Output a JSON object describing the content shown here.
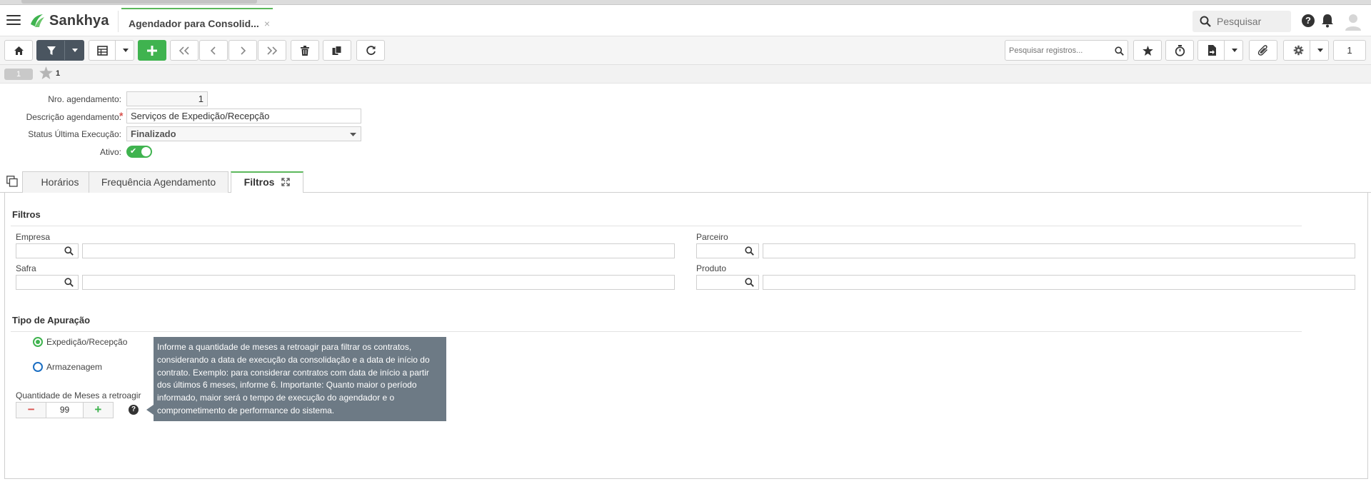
{
  "header": {
    "brand": "Sankhya",
    "app_tab_title": "Agendador para Consolid...",
    "close_label": "×",
    "search_placeholder": "Pesquisar",
    "help_label": "?"
  },
  "toolbar": {
    "search_placeholder": "Pesquisar registros...",
    "page_number": "1",
    "icons": [
      "home-icon",
      "filter-icon",
      "grid-icon",
      "add-icon",
      "first-icon",
      "prev-icon",
      "next-icon",
      "last-icon",
      "trash-icon",
      "duplicate-icon",
      "refresh-icon",
      "star-icon",
      "timer-icon",
      "report-icon",
      "attach-icon",
      "gear-icon"
    ]
  },
  "record_bar": {
    "pill": "1",
    "record_number": "1"
  },
  "form": {
    "nro_label": "Nro. agendamento:",
    "nro_value": "1",
    "descricao_label": "Descrição agendamento:",
    "required_mark": "*",
    "descricao_value": "Serviços de Expedição/Recepção",
    "status_label": "Status Última Execução:",
    "status_value": "Finalizado",
    "ativo_label": "Ativo:",
    "ativo_on": true
  },
  "tabs": [
    {
      "label": "Horários",
      "active": false
    },
    {
      "label": "Frequência Agendamento",
      "active": false
    },
    {
      "label": "Filtros",
      "active": true
    }
  ],
  "filtros": {
    "title": "Filtros",
    "empresa_label": "Empresa",
    "parceiro_label": "Parceiro",
    "safra_label": "Safra",
    "produto_label": "Produto"
  },
  "apuracao": {
    "title": "Tipo de Apuração",
    "option_1": "Expedição/Recepção",
    "option_2": "Armazenagem",
    "selected": "Expedição/Recepção",
    "meses_label": "Quantidade de Meses a retroagir",
    "meses_value": "99",
    "minus_label": "−",
    "plus_label": "+",
    "help_label": "?"
  },
  "tooltip": {
    "text": "Informe a quantidade de meses a retroagir para filtrar os contratos, considerando a data de execução da consolidação e a data de início do contrato. Exemplo: para considerar contratos com data de início a partir dos últimos 6 meses, informe 6. Importante: Quanto maior o período informado, maior será o tempo de execução do agendador e o comprometimento de performance do sistema."
  },
  "colors": {
    "accent_green": "#3fb34f",
    "toolbar_dark": "#4a5560",
    "tooltip_bg": "#6d7a85",
    "required_red": "#d9534f"
  }
}
